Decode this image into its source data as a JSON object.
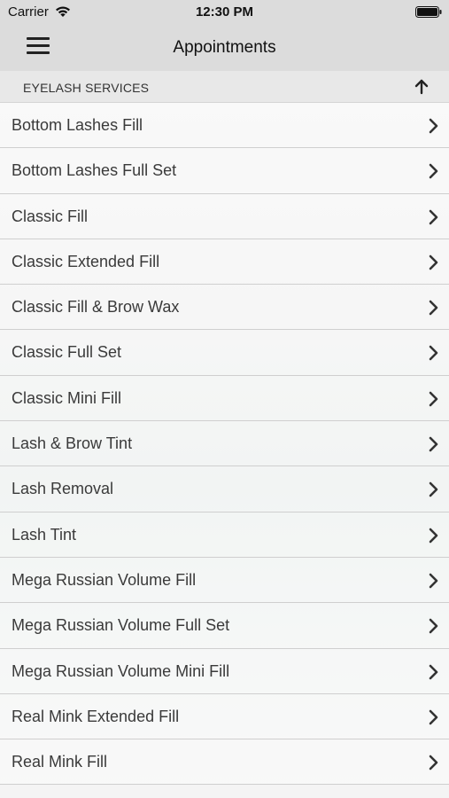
{
  "status_bar": {
    "carrier": "Carrier",
    "time": "12:30 PM",
    "wifi_icon": "wifi-icon",
    "battery_icon": "battery-icon"
  },
  "nav_bar": {
    "menu_icon": "hamburger-menu-icon",
    "title": "Appointments"
  },
  "section": {
    "label": "EYELASH SERVICES",
    "collapse_icon": "arrow-up-icon"
  },
  "services": [
    {
      "label": "Bottom Lashes Fill"
    },
    {
      "label": "Bottom Lashes Full Set"
    },
    {
      "label": "Classic Fill"
    },
    {
      "label": "Classic Extended Fill"
    },
    {
      "label": "Classic Fill & Brow Wax"
    },
    {
      "label": "Classic Full Set"
    },
    {
      "label": "Classic Mini Fill"
    },
    {
      "label": "Lash & Brow Tint"
    },
    {
      "label": "Lash Removal"
    },
    {
      "label": "Lash Tint"
    },
    {
      "label": "Mega Russian Volume Fill"
    },
    {
      "label": "Mega Russian Volume Full Set"
    },
    {
      "label": "Mega Russian Volume Mini Fill"
    },
    {
      "label": "Real Mink Extended Fill"
    },
    {
      "label": "Real Mink Fill"
    }
  ],
  "colors": {
    "header_bg": "#dcdcdc",
    "section_bg": "#e8e8e8",
    "text": "#3a3a3a",
    "divider": "#cfcfcf"
  }
}
